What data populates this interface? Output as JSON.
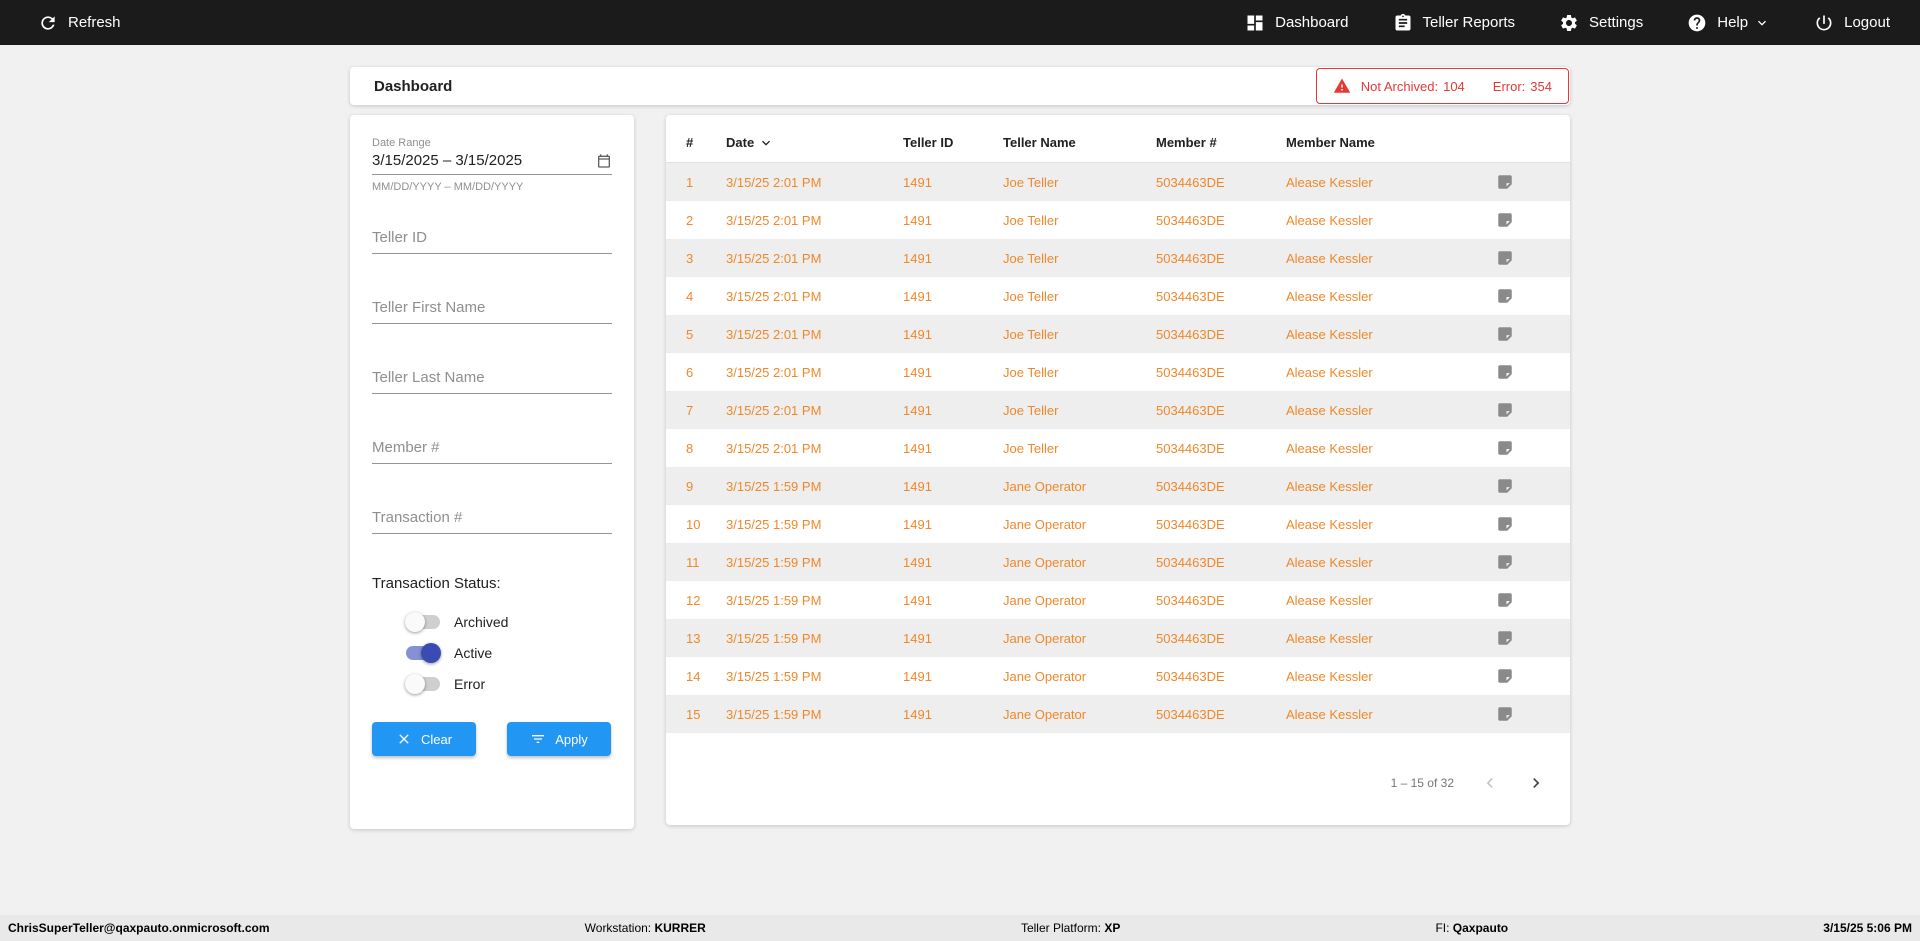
{
  "colors": {
    "topbar_bg": "#1B1B1B",
    "accent_orange": "#F0882A",
    "alert_red": "#E53935",
    "button_blue": "#2196F3",
    "toggle_on_knob": "#3A4CB1",
    "toggle_on_track": "#8591D5"
  },
  "topbar": {
    "refresh_label": "Refresh",
    "nav": [
      {
        "label": "Dashboard"
      },
      {
        "label": "Teller Reports"
      },
      {
        "label": "Settings"
      },
      {
        "label": "Help"
      },
      {
        "label": "Logout"
      }
    ]
  },
  "header": {
    "title": "Dashboard",
    "alert": {
      "not_archived_label": "Not Archived:",
      "not_archived_count": "104",
      "error_label": "Error:",
      "error_count": "354"
    }
  },
  "filters": {
    "date_range": {
      "label": "Date Range",
      "value": "3/15/2025 – 3/15/2025",
      "helper": "MM/DD/YYYY – MM/DD/YYYY"
    },
    "teller_id_placeholder": "Teller ID",
    "teller_first_name_placeholder": "Teller First Name",
    "teller_last_name_placeholder": "Teller Last Name",
    "member_placeholder": "Member #",
    "transaction_placeholder": "Transaction #",
    "status_label": "Transaction Status:",
    "toggles": [
      {
        "label": "Archived",
        "on": false
      },
      {
        "label": "Active",
        "on": true
      },
      {
        "label": "Error",
        "on": false
      }
    ],
    "clear_label": "Clear",
    "apply_label": "Apply"
  },
  "table": {
    "columns": [
      "#",
      "Date",
      "Teller ID",
      "Teller Name",
      "Member #",
      "Member Name"
    ],
    "rows": [
      {
        "num": "1",
        "date": "3/15/25 2:01 PM",
        "teller_id": "1491",
        "teller_name": "Joe Teller",
        "member_num": "5034463DE",
        "member_name": "Alease Kessler"
      },
      {
        "num": "2",
        "date": "3/15/25 2:01 PM",
        "teller_id": "1491",
        "teller_name": "Joe Teller",
        "member_num": "5034463DE",
        "member_name": "Alease Kessler"
      },
      {
        "num": "3",
        "date": "3/15/25 2:01 PM",
        "teller_id": "1491",
        "teller_name": "Joe Teller",
        "member_num": "5034463DE",
        "member_name": "Alease Kessler"
      },
      {
        "num": "4",
        "date": "3/15/25 2:01 PM",
        "teller_id": "1491",
        "teller_name": "Joe Teller",
        "member_num": "5034463DE",
        "member_name": "Alease Kessler"
      },
      {
        "num": "5",
        "date": "3/15/25 2:01 PM",
        "teller_id": "1491",
        "teller_name": "Joe Teller",
        "member_num": "5034463DE",
        "member_name": "Alease Kessler"
      },
      {
        "num": "6",
        "date": "3/15/25 2:01 PM",
        "teller_id": "1491",
        "teller_name": "Joe Teller",
        "member_num": "5034463DE",
        "member_name": "Alease Kessler"
      },
      {
        "num": "7",
        "date": "3/15/25 2:01 PM",
        "teller_id": "1491",
        "teller_name": "Joe Teller",
        "member_num": "5034463DE",
        "member_name": "Alease Kessler"
      },
      {
        "num": "8",
        "date": "3/15/25 2:01 PM",
        "teller_id": "1491",
        "teller_name": "Joe Teller",
        "member_num": "5034463DE",
        "member_name": "Alease Kessler"
      },
      {
        "num": "9",
        "date": "3/15/25 1:59 PM",
        "teller_id": "1491",
        "teller_name": "Jane Operator",
        "member_num": "5034463DE",
        "member_name": "Alease Kessler"
      },
      {
        "num": "10",
        "date": "3/15/25 1:59 PM",
        "teller_id": "1491",
        "teller_name": "Jane Operator",
        "member_num": "5034463DE",
        "member_name": "Alease Kessler"
      },
      {
        "num": "11",
        "date": "3/15/25 1:59 PM",
        "teller_id": "1491",
        "teller_name": "Jane Operator",
        "member_num": "5034463DE",
        "member_name": "Alease Kessler"
      },
      {
        "num": "12",
        "date": "3/15/25 1:59 PM",
        "teller_id": "1491",
        "teller_name": "Jane Operator",
        "member_num": "5034463DE",
        "member_name": "Alease Kessler"
      },
      {
        "num": "13",
        "date": "3/15/25 1:59 PM",
        "teller_id": "1491",
        "teller_name": "Jane Operator",
        "member_num": "5034463DE",
        "member_name": "Alease Kessler"
      },
      {
        "num": "14",
        "date": "3/15/25 1:59 PM",
        "teller_id": "1491",
        "teller_name": "Jane Operator",
        "member_num": "5034463DE",
        "member_name": "Alease Kessler"
      },
      {
        "num": "15",
        "date": "3/15/25 1:59 PM",
        "teller_id": "1491",
        "teller_name": "Jane Operator",
        "member_num": "5034463DE",
        "member_name": "Alease Kessler"
      }
    ],
    "pagination": {
      "range_label": "1 – 15 of 32"
    }
  },
  "statusbar": {
    "user": "ChrisSuperTeller@qaxpauto.onmicrosoft.com",
    "workstation_label": "Workstation:",
    "workstation": "KURRER",
    "platform_label": "Teller Platform:",
    "platform": "XP",
    "fi_label": "FI:",
    "fi": "Qaxpauto",
    "datetime": "3/15/25 5:06 PM"
  }
}
